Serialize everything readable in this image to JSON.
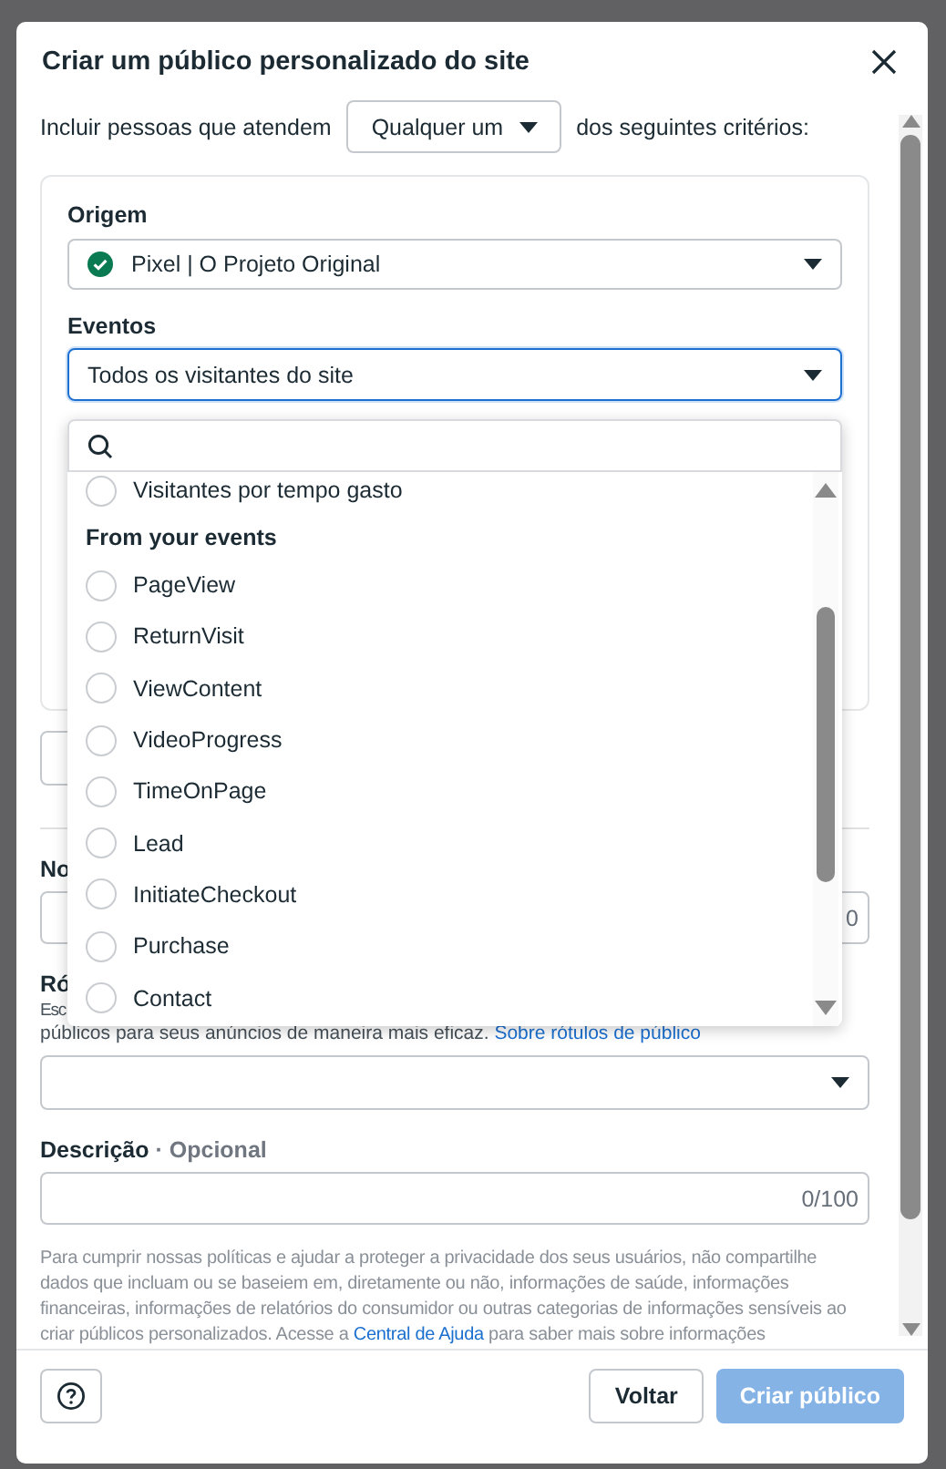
{
  "dialog": {
    "title": "Criar um público personalizado do site"
  },
  "criteria": {
    "prefix": "Incluir pessoas que atendem",
    "select": "Qualquer um",
    "suffix": "dos seguintes critérios:"
  },
  "rule": {
    "source_label": "Origem",
    "source_value": "Pixel | O Projeto Original",
    "events_label": "Eventos",
    "events_value": "Todos os visitantes do site",
    "events_focused": true
  },
  "events_menu": {
    "items": [
      {
        "kind": "option",
        "label": "Visitantes por tempo gasto",
        "selected": false
      },
      {
        "kind": "header",
        "label": "From your events"
      },
      {
        "kind": "option",
        "label": "PageView",
        "selected": false
      },
      {
        "kind": "option",
        "label": "ReturnVisit",
        "selected": false
      },
      {
        "kind": "option",
        "label": "ViewContent",
        "selected": false
      },
      {
        "kind": "option",
        "label": "VideoProgress",
        "selected": false
      },
      {
        "kind": "option",
        "label": "TimeOnPage",
        "selected": false
      },
      {
        "kind": "option",
        "label": "Lead",
        "selected": false
      },
      {
        "kind": "option",
        "label": "InitiateCheckout",
        "selected": false
      },
      {
        "kind": "option",
        "label": "Purchase",
        "selected": false
      },
      {
        "kind": "option",
        "label": "Contact",
        "selected": false
      }
    ]
  },
  "name_field": {
    "label": "No",
    "counter": "0"
  },
  "labels_field": {
    "label": "Ró",
    "hint_start": "Esc",
    "hint": "públicos para seus anúncios de maneira mais eficaz.",
    "link": "Sobre rótulos de público"
  },
  "description": {
    "label": "Descrição",
    "optional": "· Opcional",
    "counter": "0/100"
  },
  "notice": {
    "text": "Para cumprir nossas políticas e ajudar a proteger a privacidade dos seus usuários, não compartilhe dados que incluam ou se baseiem em, diretamente ou não, informações de saúde, informações financeiras, informações de relatórios do consumidor ou outras categorias de informações sensíveis ao criar públicos personalizados. Acesse a",
    "link": "Central de Ajuda",
    "text_after": "para saber mais sobre informações"
  },
  "footer": {
    "back": "Voltar",
    "create": "Criar público",
    "create_disabled": true
  }
}
